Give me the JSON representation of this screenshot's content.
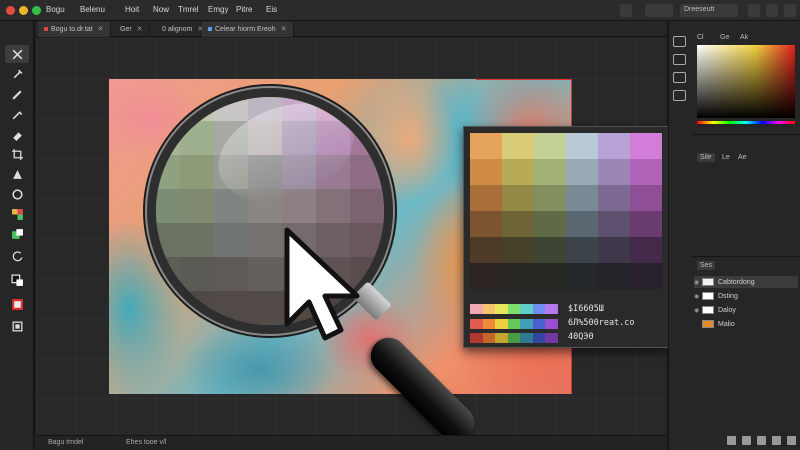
{
  "menubar": {
    "traffic_colors": [
      "#e84c3d",
      "#f0b429",
      "#33c148"
    ],
    "items": [
      "Bogu",
      "Belenu",
      "Hoit",
      "Now",
      "Tmrel",
      "Emgy",
      "Pitre",
      "Eis"
    ],
    "right_field": "Dreeseutt"
  },
  "tabs": [
    {
      "label": "Bogu to.dr.tat",
      "marker": "#d94848"
    },
    {
      "label": "Ger",
      "marker": ""
    },
    {
      "label": "0 alignom",
      "marker": ""
    },
    {
      "label": "Celear hiorm Ereoh",
      "marker": "#5aa0f0"
    }
  ],
  "toolbar": {
    "tools": [
      "move-icon",
      "eyedropper-icon",
      "brush-icon",
      "pen-icon",
      "eraser-icon",
      "crop-icon",
      "fill-icon",
      "shape-icon",
      "color-picker-icon",
      "swatch-icon",
      "rotate-icon",
      "foreground-background-icon",
      "palette-icon",
      "screen-mode-icon"
    ]
  },
  "swatch_popup": {
    "grid_colors": [
      [
        "#e6a35a",
        "#d9cd7a",
        "#c4d29a",
        "#b9c9d6",
        "#b9a2d6",
        "#d27ed8"
      ],
      [
        "#d08c44",
        "#b7ab58",
        "#a2b278",
        "#98aab5",
        "#9b85b5",
        "#b263ba"
      ],
      [
        "#a87038",
        "#938846",
        "#81905e",
        "#788a93",
        "#7c6a93",
        "#8f4f96"
      ],
      [
        "#7c5530",
        "#6d6537",
        "#5f6b47",
        "#5a6770",
        "#5e5170",
        "#6a3c70"
      ],
      [
        "#4e3a26",
        "#46422a",
        "#3e4534",
        "#3c444a",
        "#3f384a",
        "#45294a"
      ],
      [
        "#2c2420",
        "#282620",
        "#252822",
        "#24282a",
        "#25232a",
        "#28202a"
      ]
    ],
    "strips": [
      [
        "#f2a7b5",
        "#f4c56c",
        "#e5e85a",
        "#7de06c",
        "#5fd0c8",
        "#6f8ef0",
        "#b578ee"
      ],
      [
        "#e35a4e",
        "#ef8a3a",
        "#ecd040",
        "#62c85a",
        "#3fa0b8",
        "#4a62d0",
        "#9850d0"
      ],
      [
        "#b0382e",
        "#c5662a",
        "#c5a52c",
        "#4b9a44",
        "#2f7a8e",
        "#3646a0",
        "#7238a2"
      ]
    ],
    "labels": [
      "$I6605Ш",
      "6Л%500reat.co",
      "40QЭ0"
    ]
  },
  "right_panel": {
    "tab_labels": [
      "Cl",
      "Ge",
      "Ak"
    ],
    "sub_tabs": [
      "Sile",
      "Le",
      "Ae"
    ],
    "layers_tab": "Ses",
    "layers": [
      {
        "name": "Cabtordong",
        "thumb": "#f2f2f2",
        "selected": true
      },
      {
        "name": "Dsting",
        "thumb": "#ffffff",
        "selected": false
      },
      {
        "name": "Daloy",
        "thumb": "#ffffff",
        "selected": false
      },
      {
        "name": "Malio",
        "thumb": "#e58a2a",
        "selected": false
      }
    ]
  },
  "statusbar": {
    "left": "Bagu tmdel",
    "middle": "Ehes tooe v/l"
  },
  "lens_colors": [
    [
      "#b9a9b0",
      "#c2c9b0",
      "#c9c6c6",
      "#bcb6c2",
      "#c3a8c7",
      "#c995bf",
      "#bb8eb2",
      "#b08ca5"
    ],
    [
      "#a6b495",
      "#9eb08e",
      "#a7a9a2",
      "#bcb3b5",
      "#a796b2",
      "#b083b0",
      "#a27798",
      "#9d7a86"
    ],
    [
      "#8ea281",
      "#8d9b78",
      "#969a92",
      "#8c8c8c",
      "#998da1",
      "#987a95",
      "#8e6d84",
      "#8b6a74"
    ],
    [
      "#7d8c74",
      "#7f8a70",
      "#7f8580",
      "#8a8684",
      "#8e7f86",
      "#847078",
      "#7c636f",
      "#7a5f68"
    ],
    [
      "#6a7263",
      "#6c7264",
      "#707472",
      "#777270",
      "#756b6e",
      "#6f6065",
      "#6a565d",
      "#6b5558"
    ],
    [
      "#5e5e58",
      "#5c5a55",
      "#5f5a56",
      "#64605c",
      "#625a58",
      "#5e5252",
      "#5a4d4d",
      "#5c4a48"
    ],
    [
      "#4f4b47",
      "#4e4946",
      "#514a46",
      "#524b47",
      "#524945",
      "#4f4442",
      "#4c403e",
      "#4d3f3b"
    ],
    [
      "#42403c",
      "#403c39",
      "#423b38",
      "#433c39",
      "#413935",
      "#3f3634",
      "#3c3331",
      "#3e3230"
    ]
  ]
}
